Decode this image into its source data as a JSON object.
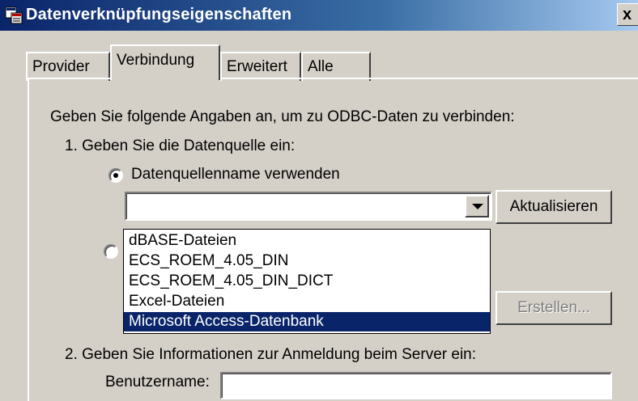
{
  "window": {
    "title": "Datenverknüpfungseigenschaften",
    "close_label": "x"
  },
  "tabs": [
    {
      "label": "Provider",
      "active": false
    },
    {
      "label": "Verbindung",
      "active": true
    },
    {
      "label": "Erweitert",
      "active": false
    },
    {
      "label": "Alle",
      "active": false
    }
  ],
  "panel": {
    "instruction": "Geben Sie folgende Angaben an, um zu ODBC-Daten zu verbinden:",
    "step1": "1. Geben Sie die Datenquelle ein:",
    "radio_dsn_label": "Datenquellenname verwenden",
    "combo_value": "",
    "refresh_button": "Aktualisieren",
    "create_button": "Erstellen...",
    "step2": "2. Geben Sie Informationen zur Anmeldung beim Server ein:",
    "username_label": "Benutzername:",
    "username_value": ""
  },
  "dropdown": {
    "items": [
      "dBASE-Dateien",
      "ECS_ROEM_4.05_DIN",
      "ECS_ROEM_4.05_DIN_DICT",
      "Excel-Dateien",
      "Microsoft Access-Datenbank"
    ],
    "selected": "Microsoft Access-Datenbank"
  }
}
